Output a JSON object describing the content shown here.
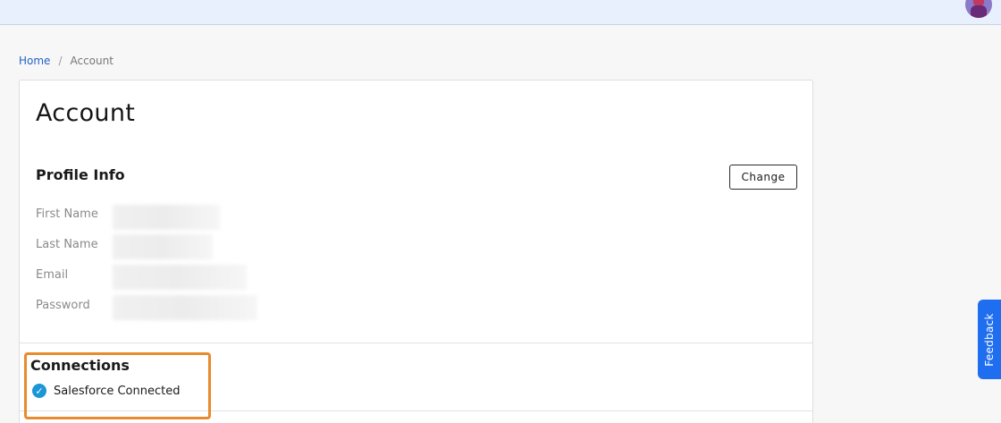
{
  "header": {
    "avatar_icon": "user-avatar"
  },
  "breadcrumb": {
    "home": "Home",
    "separator": "/",
    "current": "Account"
  },
  "page": {
    "title": "Account"
  },
  "profile": {
    "section_title": "Profile Info",
    "change_label": "Change",
    "fields": [
      {
        "label": "First Name"
      },
      {
        "label": "Last Name"
      },
      {
        "label": "Email"
      },
      {
        "label": "Password"
      }
    ]
  },
  "connections": {
    "section_title": "Connections",
    "items": [
      {
        "label": "Salesforce Connected",
        "icon": "check-circle-icon",
        "status_color": "#1b96d6"
      }
    ]
  },
  "feedback": {
    "label": "Feedback",
    "color": "#1f6ef0"
  },
  "highlight": {
    "color": "#e88a2e"
  }
}
